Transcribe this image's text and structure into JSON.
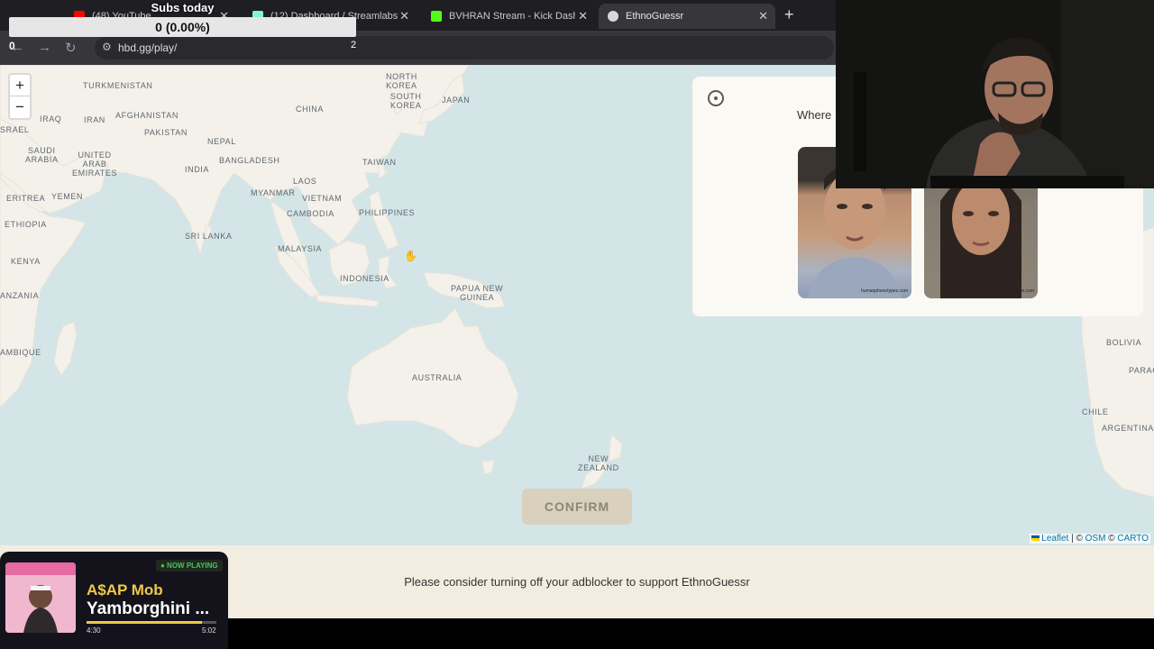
{
  "browser": {
    "tabs": [
      {
        "label": "(48) YouTube",
        "favicon_color": "#ff0000"
      },
      {
        "label": "(12) Dashboard / Streamlabs",
        "favicon_color": "#80f5d2"
      },
      {
        "label": "BVHRAN Stream - Kick Dashboard",
        "favicon_color": "#53fc18"
      },
      {
        "label": "EthnoGuessr",
        "favicon_color": "#d8d8d8"
      }
    ],
    "new_tab_glyph": "+",
    "close_glyph": "✕",
    "url": "hbd.gg/play/"
  },
  "overlay": {
    "subs_title": "Subs today",
    "subs_value": "0 (0.00%)",
    "subs_left": "0",
    "subs_right": "2"
  },
  "map": {
    "zoom_in": "+",
    "zoom_out": "−",
    "labels": {
      "north_korea": "NORTH\nKOREA",
      "south_korea": "SOUTH\nKOREA",
      "japan": "JAPAN",
      "china": "CHINA",
      "turkmenistan": "TURKMENISTAN",
      "iraq": "IRAQ",
      "iran": "IRAN",
      "afghanistan": "AFGHANISTAN",
      "pakistan": "PAKISTAN",
      "nepal": "NEPAL",
      "israel": "SRAEL",
      "saudi_arabia": "SAUDI\nARABIA",
      "uae": "UNITED\nARAB\nEMIRATES",
      "india": "INDIA",
      "bangladesh": "BANGLADESH",
      "taiwan": "TAIWAN",
      "laos": "LAOS",
      "myanmar": "MYANMAR",
      "vietnam": "VIETNAM",
      "eritrea": "ERITREA",
      "yemen": "YEMEN",
      "cambodia": "CAMBODIA",
      "philippines": "PHILIPPINES",
      "ethiopia": "ETHIOPIA",
      "sri_lanka": "SRI LANKA",
      "malaysia": "MALAYSIA",
      "kenya": "KENYA",
      "indonesia": "INDONESIA",
      "png": "PAPUA NEW\nGUINEA",
      "tanzania": "ANZANIA",
      "mozambique": "AMBIQUE",
      "australia": "AUSTRALIA",
      "new_zealand": "NEW\nZEALAND",
      "bolivia": "BOLIVIA",
      "paraguay": "PARAG",
      "chile": "CHILE",
      "argentina": "ARGENTINA"
    },
    "confirm_label": "CONFIRM",
    "attribution": {
      "leaflet": "Leaflet",
      "sep": "|",
      "copy1": "©",
      "osm": "OSM",
      "copy2": "©",
      "carto": "CARTO"
    }
  },
  "panel": {
    "question": "Where",
    "face_credit": "humanphenotypes.com"
  },
  "adbar": {
    "message": "Please consider turning off your adblocker to support EthnoGuessr"
  },
  "now_playing": {
    "badge": "● NOW PLAYING",
    "artist": "A$AP Mob",
    "title": "Yamborghini ...",
    "elapsed": "4:30",
    "duration": "5:02",
    "progress": 0.89
  }
}
